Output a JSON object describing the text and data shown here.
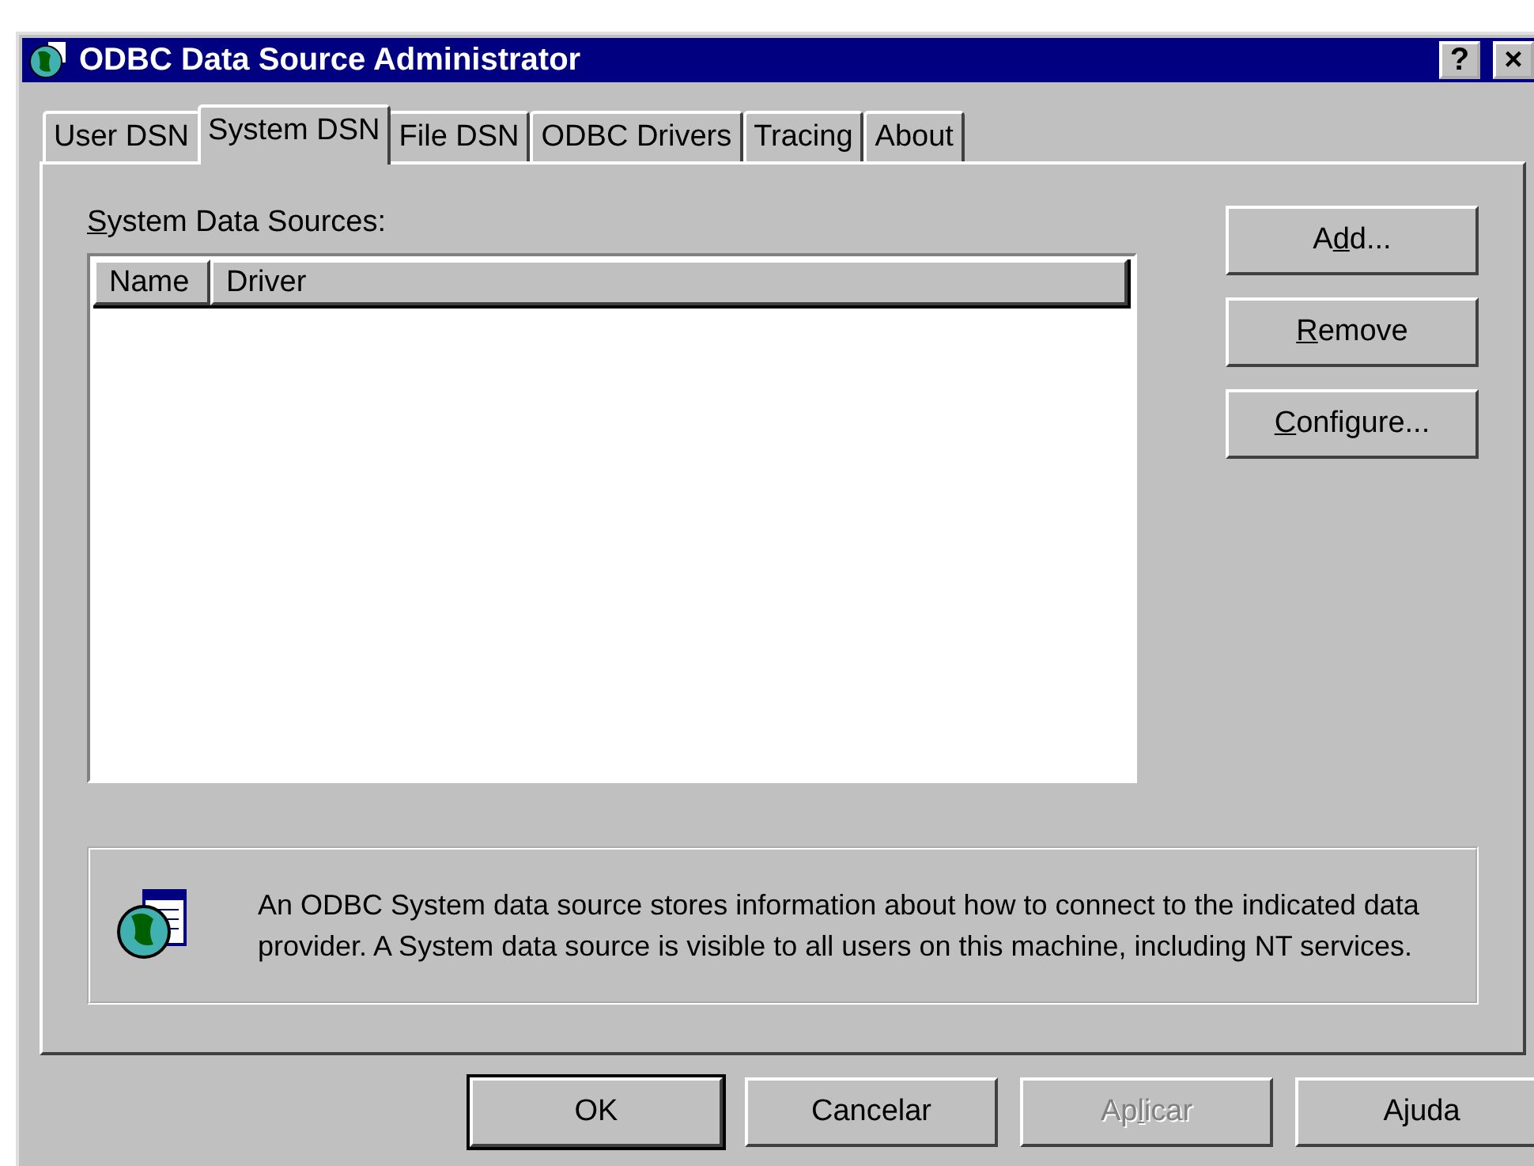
{
  "window": {
    "title": "ODBC Data Source Administrator",
    "title_buttons": [
      "?",
      "×"
    ]
  },
  "tabs": [
    {
      "label": "User DSN",
      "selected": false
    },
    {
      "label": "System DSN",
      "selected": true
    },
    {
      "label": "File DSN",
      "selected": false
    },
    {
      "label": "ODBC Drivers",
      "selected": false
    },
    {
      "label": "Tracing",
      "selected": false
    },
    {
      "label": "About",
      "selected": false
    }
  ],
  "list_label": {
    "key": "S",
    "after": "ystem Data Sources:"
  },
  "table": {
    "columns": [
      "Name",
      "Driver"
    ]
  },
  "side_buttons": [
    {
      "label_parts": {
        "before": "A",
        "key": "d",
        "after": "d..."
      },
      "disabled": false
    },
    {
      "label_parts": {
        "key": "R",
        "after": "emove"
      },
      "disabled": false
    },
    {
      "label_parts": {
        "key": "C",
        "after": "onfigure..."
      },
      "disabled": false
    }
  ],
  "info": "An ODBC System data source stores information about how to connect to the indicated data provider.  A System data source is visible to all users on this machine, including NT services.",
  "footer_buttons": [
    {
      "label_parts": {
        "before": "OK"
      },
      "disabled": false,
      "default": true
    },
    {
      "label_parts": {
        "before": "Cancelar"
      },
      "disabled": false,
      "default": false
    },
    {
      "label_parts": {
        "before": "Ap",
        "key": "l",
        "after": "icar"
      },
      "disabled": true,
      "default": false
    },
    {
      "label_parts": {
        "before": "Ajuda"
      },
      "disabled": false,
      "default": false
    }
  ]
}
